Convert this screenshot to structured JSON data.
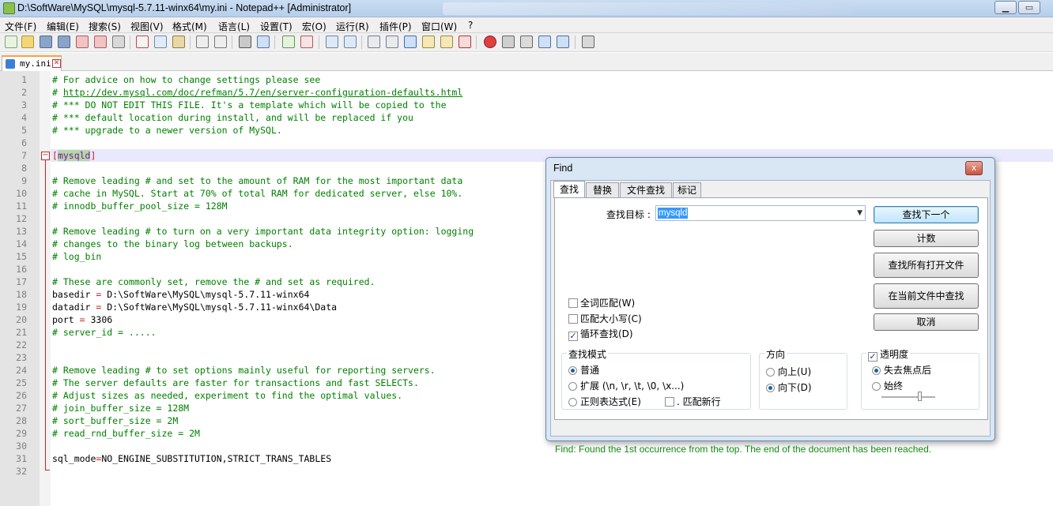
{
  "window": {
    "title": "D:\\SoftWare\\MySQL\\mysql-5.7.11-winx64\\my.ini - Notepad++ [Administrator]",
    "minimize_glyph": "▁",
    "maximize_glyph": "▭"
  },
  "menu": [
    "文件(F)",
    "编辑(E)",
    "搜索(S)",
    "视图(V)",
    "格式(M)",
    "语言(L)",
    "设置(T)",
    "宏(O)",
    "运行(R)",
    "插件(P)",
    "窗口(W)",
    "?"
  ],
  "tab": {
    "label": "my.ini",
    "close_glyph": "✕"
  },
  "editor": {
    "lines": [
      {
        "n": "1",
        "kind": "comment",
        "text": "# For advice on how to change settings please see"
      },
      {
        "n": "2",
        "kind": "link",
        "prefix": "# ",
        "text": "http://dev.mysql.com/doc/refman/5.7/en/server-configuration-defaults.html"
      },
      {
        "n": "3",
        "kind": "comment",
        "text": "# *** DO NOT EDIT THIS FILE. It's a template which will be copied to the"
      },
      {
        "n": "4",
        "kind": "comment",
        "text": "# *** default location during install, and will be replaced if you"
      },
      {
        "n": "5",
        "kind": "comment",
        "text": "# *** upgrade to a newer version of MySQL."
      },
      {
        "n": "6",
        "kind": "blank",
        "text": ""
      },
      {
        "n": "7",
        "kind": "section",
        "text": "mysqld"
      },
      {
        "n": "8",
        "kind": "blank",
        "text": ""
      },
      {
        "n": "9",
        "kind": "comment",
        "text": "# Remove leading # and set to the amount of RAM for the most important data"
      },
      {
        "n": "10",
        "kind": "comment",
        "text": "# cache in MySQL. Start at 70% of total RAM for dedicated server, else 10%."
      },
      {
        "n": "11",
        "kind": "comment",
        "text": "# innodb_buffer_pool_size = 128M"
      },
      {
        "n": "12",
        "kind": "blank",
        "text": ""
      },
      {
        "n": "13",
        "kind": "comment",
        "text": "# Remove leading # to turn on a very important data integrity option: logging"
      },
      {
        "n": "14",
        "kind": "comment",
        "text": "# changes to the binary log between backups."
      },
      {
        "n": "15",
        "kind": "comment",
        "text": "# log_bin"
      },
      {
        "n": "16",
        "kind": "blank",
        "text": ""
      },
      {
        "n": "17",
        "kind": "comment",
        "text": "# These are commonly set, remove the # and set as required."
      },
      {
        "n": "18",
        "kind": "kv",
        "key": "basedir ",
        "value": " D:\\SoftWare\\MySQL\\mysql-5.7.11-winx64"
      },
      {
        "n": "19",
        "kind": "kv",
        "key": "datadir ",
        "value": " D:\\SoftWare\\MySQL\\mysql-5.7.11-winx64\\Data"
      },
      {
        "n": "20",
        "kind": "kv",
        "key": "port ",
        "value": " 3306"
      },
      {
        "n": "21",
        "kind": "comment",
        "text": "# server_id = ....."
      },
      {
        "n": "22",
        "kind": "blank",
        "text": ""
      },
      {
        "n": "23",
        "kind": "blank",
        "text": ""
      },
      {
        "n": "24",
        "kind": "comment",
        "text": "# Remove leading # to set options mainly useful for reporting servers."
      },
      {
        "n": "25",
        "kind": "comment",
        "text": "# The server defaults are faster for transactions and fast SELECTs."
      },
      {
        "n": "26",
        "kind": "comment",
        "text": "# Adjust sizes as needed, experiment to find the optimal values."
      },
      {
        "n": "27",
        "kind": "comment",
        "text": "# join_buffer_size = 128M"
      },
      {
        "n": "28",
        "kind": "comment",
        "text": "# sort_buffer_size = 2M"
      },
      {
        "n": "29",
        "kind": "comment",
        "text": "# read_rnd_buffer_size = 2M"
      },
      {
        "n": "30",
        "kind": "blank",
        "text": ""
      },
      {
        "n": "31",
        "kind": "kv",
        "key": "sql_mode",
        "value": "NO_ENGINE_SUBSTITUTION,STRICT_TRANS_TABLES"
      },
      {
        "n": "32",
        "kind": "blank",
        "text": ""
      }
    ]
  },
  "find_dialog": {
    "title": "Find",
    "close_glyph": "x",
    "tabs": [
      "查找",
      "替换",
      "文件查找",
      "标记"
    ],
    "search_label": "查找目标 :",
    "search_value": "mysqld",
    "buttons": {
      "find_next": "查找下一个",
      "count": "计数",
      "find_all_open": "查找所有打开文件",
      "find_all_current": "在当前文件中查找",
      "cancel": "取消"
    },
    "options": {
      "whole_word": {
        "label": "全词匹配(W)",
        "checked": false
      },
      "match_case": {
        "label": "匹配大小写(C)",
        "checked": false
      },
      "wrap_around": {
        "label": "循环查找(D)",
        "checked": true
      }
    },
    "search_mode": {
      "title": "查找模式",
      "normal": "普通",
      "extended": "扩展 (\\n, \\r, \\t, \\0, \\x...)",
      "regex": "正则表达式(E)",
      "dot_newline": ". 匹配新行",
      "selected": "normal"
    },
    "direction": {
      "title": "方向",
      "up": "向上(U)",
      "down": "向下(D)",
      "selected": "down"
    },
    "transparency": {
      "title": "透明度",
      "checked": true,
      "on_lose_focus": "失去焦点后",
      "always": "始终",
      "selected": "on_lose_focus",
      "level": 0.7
    },
    "status": "Find: Found the 1st occurrence from the top. The end of the document has been reached."
  }
}
